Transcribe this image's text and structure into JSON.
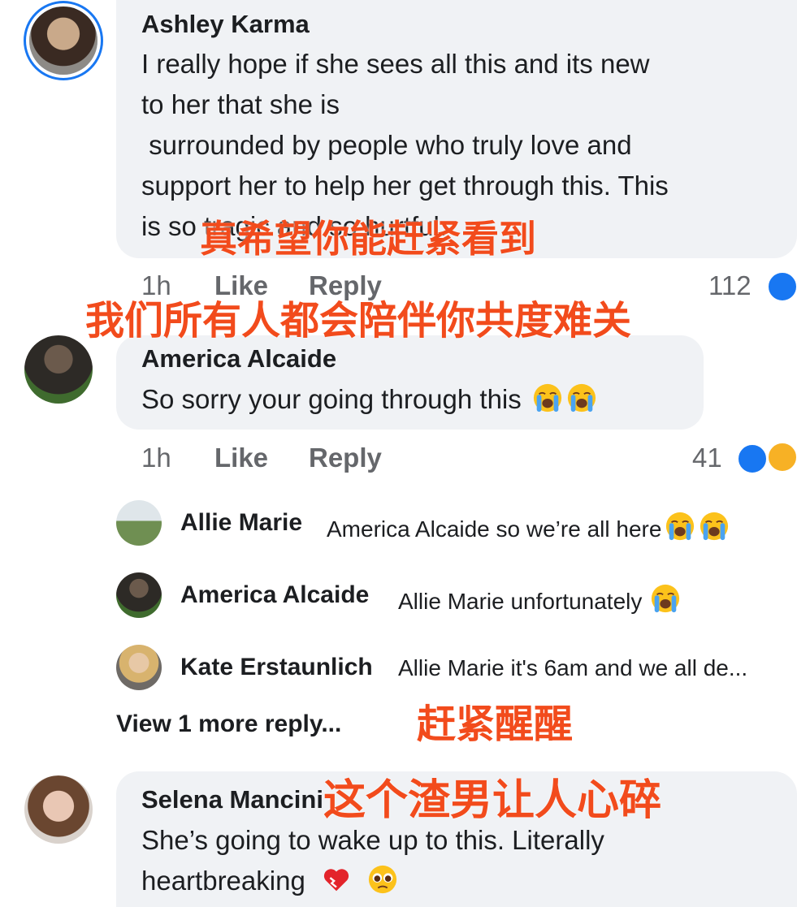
{
  "comments": [
    {
      "author": "Ashley Karma",
      "lines": [
        "I really hope if she sees all this and its new",
        "to her that she is",
        " surrounded by people who truly love and",
        "support her to help her get through this. This",
        "is so tragic and so hurtful."
      ],
      "time": "1h",
      "like": "Like",
      "reply": "Reply",
      "reactions": "112"
    },
    {
      "author": "America Alcaide",
      "text": "So sorry your going through this",
      "time": "1h",
      "like": "Like",
      "reply": "Reply",
      "reactions": "41",
      "replies": [
        {
          "author": "Allie Marie",
          "text": "America Alcaide so we’re all here"
        },
        {
          "author": "America Alcaide",
          "text": "Allie Marie unfortunately"
        },
        {
          "author": "Kate Erstaunlich",
          "text": "Allie Marie it's 6am and we all de..."
        }
      ],
      "view_more": "View 1 more reply..."
    },
    {
      "author": "Selena Mancini",
      "lines": [
        "She’s going to wake up to this. Literally",
        "heartbreaking"
      ]
    }
  ],
  "overlay_captions": [
    "真希望你能赶紧看到",
    "我们所有人都会陪伴你共度难关",
    "赶紧醒醒",
    "这个渣男让人心碎"
  ],
  "colors": {
    "overlay_text": "#f24b1c",
    "bubble": "#f0f2f5",
    "like_blue": "#1877f2",
    "meta_gray": "#65676b"
  }
}
